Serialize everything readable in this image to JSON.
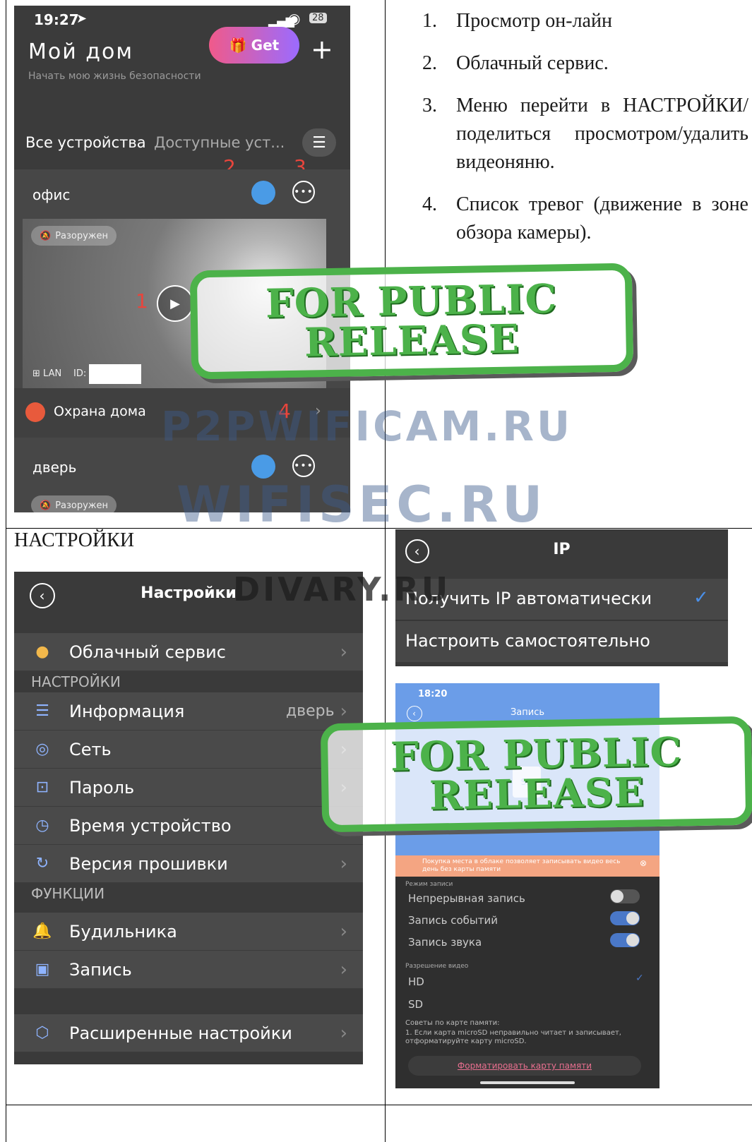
{
  "top_left_phone": {
    "status_time": "19:27",
    "battery": "28",
    "title": "Мой дом",
    "subtitle": "Начать мою жизнь безопасности",
    "get_label": "Get",
    "plus": "+",
    "tab_all": "Все устройства",
    "tab_available": "Доступные уст...",
    "device1_name": "офис",
    "disarmed": "Разоружен",
    "lan": "LAN",
    "id_label": "ID:",
    "security_label": "Охрана дома",
    "device2_name": "дверь",
    "markers": [
      "1",
      "2",
      "3",
      "4"
    ]
  },
  "instructions": [
    "Просмотр он-лайн",
    "Облачный сервис.",
    "Меню перейти в НАСТРОЙКИ/поделиться просмотром/удалить видеоняню.",
    "Список тревог (движение в зоне обзора камеры)."
  ],
  "settings_caption": "НАСТРОЙКИ",
  "settings_screen": {
    "title": "Настройки",
    "cloud": "Облачный сервис",
    "section_settings": "НАСТРОЙКИ",
    "info": "Информация",
    "info_value": "дверь",
    "network": "Сеть",
    "password": "Пароль",
    "device_time": "Время устройство",
    "firmware": "Версия прошивки",
    "section_functions": "ФУНКЦИИ",
    "alarm": "Будильника",
    "record": "Запись",
    "advanced": "Расширенные настройки"
  },
  "ip_screen": {
    "title": "IP",
    "auto": "Получить IP автоматически",
    "manual": "Настроить самостоятельно"
  },
  "record_screen": {
    "time": "18:20",
    "title": "Запись",
    "sd": "SD",
    "banner": "Покупка места в облаке позволяет записывать видео весь день без карты памяти",
    "mode_header": "Режим записи",
    "continuous": "Непрерывная запись",
    "events": "Запись событий",
    "sound": "Запись звука",
    "resolution_header": "Разрешение видео",
    "hd": "HD",
    "sd_option": "SD",
    "tips_title": "Советы по карте памяти:",
    "tips_text": "1. Если карта microSD неправильно читает и записывает, отформатируйте карту microSD.",
    "format_link": "Форматировать карту памяти"
  },
  "stamp": {
    "line1": "FOR PUBLIC",
    "line2": "RELEASE"
  },
  "watermarks": [
    "P2PWIFICAM.RU",
    "WIFISEC.RU",
    "DIVARY.RU"
  ],
  "colors": {
    "accent_green": "#4cb24a",
    "marker_red": "#e8453c",
    "cloud_blue": "#4a9be6",
    "record_blue": "#6b9de8"
  }
}
